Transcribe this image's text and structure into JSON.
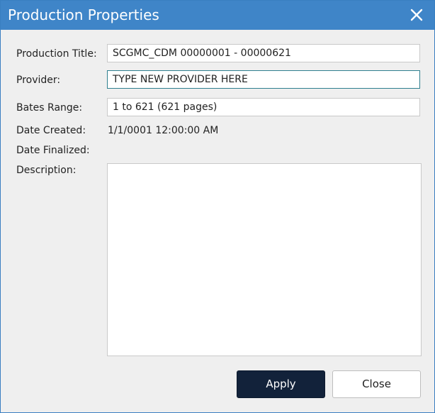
{
  "dialog": {
    "title": "Production Properties",
    "close_icon": "close-icon"
  },
  "form": {
    "production_title": {
      "label": "Production Title:",
      "value": "SCGMC_CDM 00000001 - 00000621"
    },
    "provider": {
      "label": "Provider:",
      "value": "TYPE NEW PROVIDER HERE"
    },
    "bates_range": {
      "label": "Bates Range:",
      "value": "1 to 621 (621 pages)"
    },
    "date_created": {
      "label": "Date Created:",
      "value": "1/1/0001 12:00:00 AM"
    },
    "date_finalized": {
      "label": "Date Finalized:",
      "value": ""
    },
    "description": {
      "label": "Description:",
      "value": ""
    }
  },
  "buttons": {
    "apply": "Apply",
    "close": "Close"
  },
  "colors": {
    "titlebar": "#3f85c8",
    "apply_button": "#12223a",
    "dialog_background": "#efefef"
  }
}
